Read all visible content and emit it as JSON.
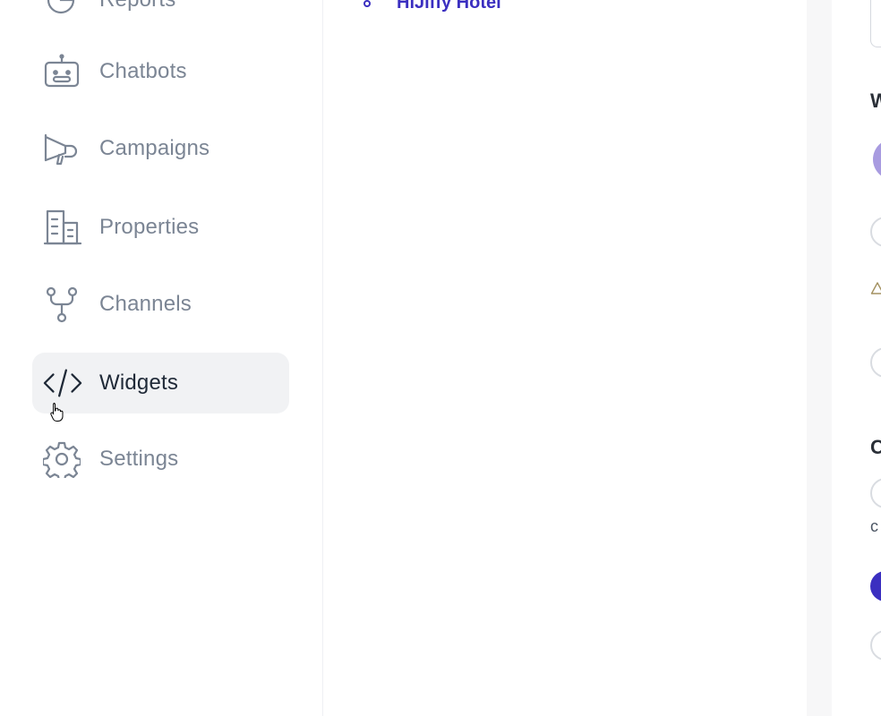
{
  "sidebar": {
    "partial_item": {
      "label": "Reports"
    },
    "items": [
      {
        "label": "Chatbots",
        "icon": "robot-icon"
      },
      {
        "label": "Campaigns",
        "icon": "megaphone-icon"
      },
      {
        "label": "Properties",
        "icon": "building-icon"
      },
      {
        "label": "Channels",
        "icon": "git-fork-icon"
      },
      {
        "label": "Widgets",
        "icon": "code-icon",
        "active": true
      },
      {
        "label": "Settings",
        "icon": "gear-icon"
      }
    ]
  },
  "tree": {
    "selected_label": "HiJiffy Hotel"
  },
  "right_panel": {
    "section_w_initial": "W",
    "section_c_initial": "C",
    "text_c_initial": "c"
  },
  "colors": {
    "accent": "#3b2fc0",
    "active_bg": "#f1f2f4",
    "swatch": "#a89be0"
  }
}
